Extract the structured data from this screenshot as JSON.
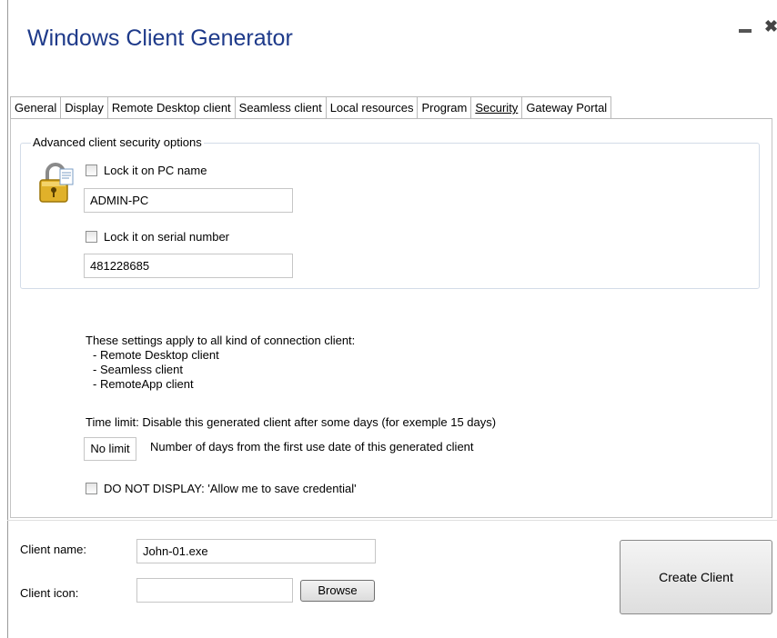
{
  "window": {
    "title": "Windows Client Generator",
    "minimize_glyph": "",
    "close_glyph": "✖"
  },
  "tabs": [
    {
      "label": "General",
      "active": false
    },
    {
      "label": "Display",
      "active": false
    },
    {
      "label": "Remote Desktop client",
      "active": false
    },
    {
      "label": "Seamless client",
      "active": false
    },
    {
      "label": "Local resources",
      "active": false
    },
    {
      "label": "Program",
      "active": false
    },
    {
      "label": "Security",
      "active": true
    },
    {
      "label": "Gateway Portal",
      "active": false
    }
  ],
  "security": {
    "group_title": "Advanced client security options",
    "lock_pc_label": "Lock it on PC name",
    "lock_pc_checked": false,
    "pc_name_value": "ADMIN-PC",
    "lock_serial_label": "Lock it on serial number",
    "lock_serial_checked": false,
    "serial_value": "481228685",
    "info_heading": "These settings apply to all kind of connection client:",
    "info_items": [
      "- Remote Desktop client",
      "- Seamless client",
      "- RemoteApp client"
    ],
    "time_limit_text": "Time limit: Disable this generated client after some days (for exemple 15 days)",
    "time_limit_value": "No limit",
    "time_limit_desc": "Number of days from the first use date of this generated client",
    "dont_display_label": "DO NOT DISPLAY: 'Allow me to save credential'",
    "dont_display_checked": false
  },
  "bottom": {
    "client_name_label": "Client name:",
    "client_name_value": "John-01.exe",
    "client_icon_label": "Client icon:",
    "client_icon_value": "",
    "browse_label": "Browse",
    "create_label": "Create Client"
  },
  "colors": {
    "title": "#1e3a8a",
    "group_border": "#d3dce8"
  }
}
